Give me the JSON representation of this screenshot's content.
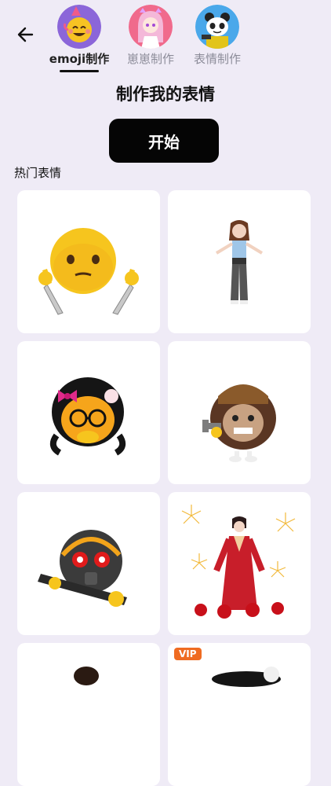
{
  "tabs": [
    {
      "label": "emoji制作",
      "icon": "smiley-emoji-icon",
      "active": true
    },
    {
      "label": "崽崽制作",
      "icon": "anime-girl-icon",
      "active": false
    },
    {
      "label": "表情制作",
      "icon": "panda-meme-icon",
      "active": false
    }
  ],
  "title": "制作我的表情",
  "start_label": "开始",
  "section_label": "热门表情",
  "vip_badge": "VIP",
  "colors": {
    "background": "#efebf6",
    "button": "#050505",
    "vip": "#ef6b21"
  }
}
